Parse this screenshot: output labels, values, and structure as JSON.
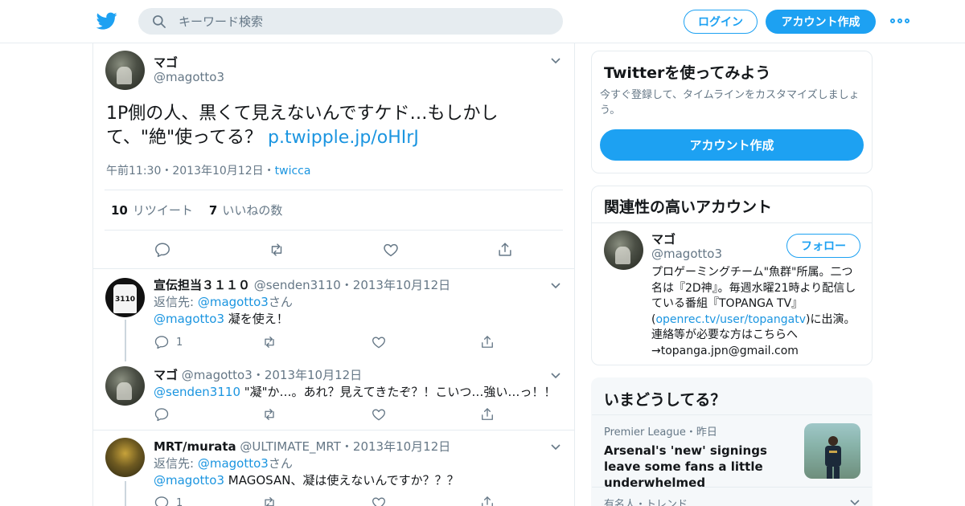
{
  "header": {
    "search_placeholder": "キーワード検索",
    "login_label": "ログイン",
    "signup_label": "アカウント作成"
  },
  "tweet": {
    "name": "マゴ",
    "handle": "@magotto3",
    "text": "1P側の人、黒くて見えないんですケド…もしかして、\"絶\"使ってる？ ",
    "link": "p.twipple.jp/oHIrJ",
    "time": "午前11:30",
    "date": "2013年10月12日",
    "source": "twicca",
    "retweets_count": "10",
    "retweets_label": "リツイート",
    "likes_count": "7",
    "likes_label": "いいねの数"
  },
  "replies": [
    {
      "name": "宣伝担当３１１０",
      "handle": "@senden3110",
      "date": "2013年10月12日",
      "reply_to_label": "返信先: ",
      "reply_to_handle": "@magotto3",
      "reply_to_suffix": "さん",
      "mention": "@magotto3",
      "text": " 凝を使え！",
      "reply_count": "1"
    },
    {
      "name": "マゴ",
      "handle": "@magotto3",
      "date": "2013年10月12日",
      "mention": "@senden3110",
      "text": " \"凝\"か…。あれ？見えてきたぞ？！こいつ…強い…っ！！"
    },
    {
      "name": "MRT/murata",
      "handle": "@ULTIMATE_MRT",
      "date": "2013年10月12日",
      "reply_to_label": "返信先: ",
      "reply_to_handle": "@magotto3",
      "reply_to_suffix": "さん",
      "mention": "@magotto3",
      "text": " MAGOSAN、凝は使えないんですか？？？",
      "reply_count": "1"
    }
  ],
  "sidebar": {
    "signup_card": {
      "title": "Twitterを使ってみよう",
      "desc": "今すぐ登録して、タイムラインをカスタマイズしましょう。",
      "button": "アカウント作成"
    },
    "related": {
      "title": "関連性の高いアカウント",
      "name": "マゴ",
      "handle": "@magotto3",
      "follow": "フォロー",
      "bio_1": "プロゲーミングチーム\"魚群\"所属。二つ名は『2D神』。毎週水曜21時より配信している番組『TOPANGA TV』(",
      "bio_link": "openrec.tv/user/topangatv",
      "bio_2": ")に出演。連絡等が必要な方はこちらへ→topanga.jpn@gmail.com"
    },
    "trends": {
      "title": "いまどうしてる？",
      "item1_meta": "Premier League・昨日",
      "item1_title": "Arsenal's 'new' signings leave some fans a little underwhelmed",
      "item2_meta": "有名人・トレンド"
    }
  },
  "colors": {
    "accent": "#1da1f2",
    "link": "#1b95e0",
    "muted": "#657786",
    "border": "#e6ecf0"
  }
}
